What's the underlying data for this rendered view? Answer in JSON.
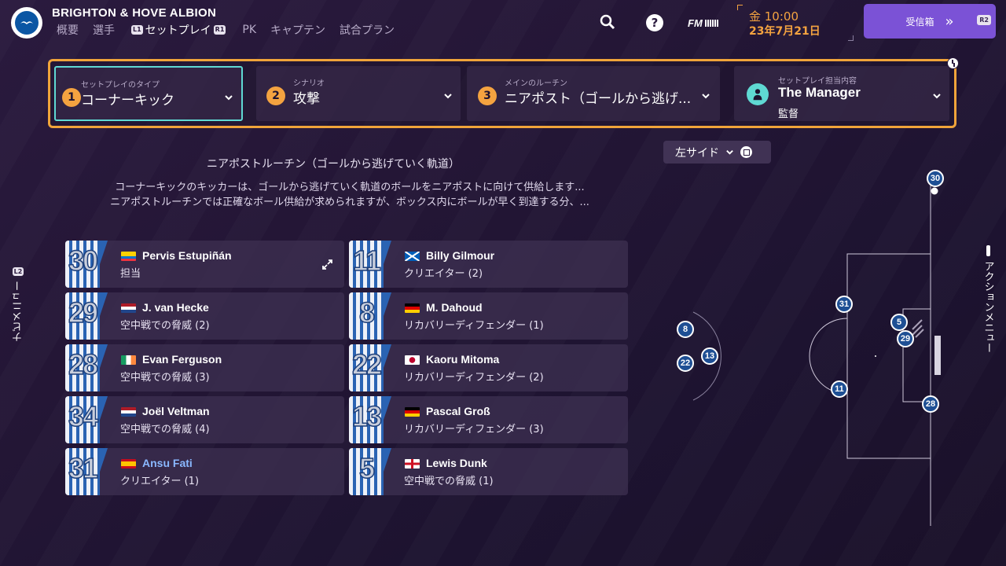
{
  "header": {
    "club_name": "BRIGHTON & HOVE ALBION",
    "nav": [
      {
        "label": "概要"
      },
      {
        "label": "選手"
      },
      {
        "label": "セットプレイ",
        "key_left": "L1",
        "key_right": "R1",
        "active": true
      },
      {
        "label": "PK"
      },
      {
        "label": "キャプテン"
      },
      {
        "label": "試合プラン"
      }
    ],
    "fm_logo": "FM",
    "help_glyph": "?",
    "date_time": "金 10:00",
    "date_date": "23年7月21日",
    "inbox_label": "受信箱",
    "inbox_arrows": "»",
    "inbox_key": "R2"
  },
  "setpiece": {
    "type": {
      "num": "1",
      "caption": "セットプレイのタイプ",
      "value": "コーナーキック"
    },
    "scenario": {
      "num": "2",
      "caption": "シナリオ",
      "value": "攻撃"
    },
    "routine": {
      "num": "3",
      "caption": "メインのルーチン",
      "value": "ニアポスト（ゴールから逃げ..."
    },
    "taker": {
      "caption": "セットプレイ担当内容",
      "value": "The Manager",
      "sub": "監督"
    }
  },
  "routine": {
    "title": "ニアポストルーチン（ゴールから逃げていく軌道）",
    "desc_line1": "コーナーキックのキッカーは、ゴールから逃げていく軌道のボールをニアポストに向けて供給します...",
    "desc_line2": "ニアポストルーチンでは正確なボール供給が求められますが、ボックス内にボールが早く到達する分、..."
  },
  "players_left": [
    {
      "num": "30",
      "name": "Pervis Estupiñán",
      "role": "担当",
      "flag": "ecuador",
      "highlight": false
    },
    {
      "num": "29",
      "name": "J. van Hecke",
      "role": "空中戦での脅威 (2)",
      "flag": "netherlands",
      "highlight": false
    },
    {
      "num": "28",
      "name": "Evan Ferguson",
      "role": "空中戦での脅威 (3)",
      "flag": "ireland",
      "highlight": false
    },
    {
      "num": "34",
      "name": "Joël Veltman",
      "role": "空中戦での脅威 (4)",
      "flag": "netherlands",
      "highlight": false
    },
    {
      "num": "31",
      "name": "Ansu Fati",
      "role": "クリエイター (1)",
      "flag": "spain",
      "highlight": true
    }
  ],
  "players_right": [
    {
      "num": "11",
      "name": "Billy Gilmour",
      "role": "クリエイター (2)",
      "flag": "scotland"
    },
    {
      "num": "8",
      "name": "M. Dahoud",
      "role": "リカバリーディフェンダー (1)",
      "flag": "germany"
    },
    {
      "num": "22",
      "name": "Kaoru Mitoma",
      "role": "リカバリーディフェンダー (2)",
      "flag": "japan"
    },
    {
      "num": "13",
      "name": "Pascal Groß",
      "role": "リカバリーディフェンダー (3)",
      "flag": "germany"
    },
    {
      "num": "5",
      "name": "Lewis Dunk",
      "role": "空中戦での脅威 (1)",
      "flag": "england"
    }
  ],
  "side_nav": {
    "key": "L2",
    "label": "ナビメニュー"
  },
  "side_actions": {
    "label": "アクションメニュー"
  },
  "pitch": {
    "side_select": "左サイド",
    "markers": [
      "30",
      "31",
      "5",
      "29",
      "8",
      "13",
      "22",
      "11",
      "28"
    ]
  },
  "colors": {
    "accent": "#f4a340",
    "highlight": "#5fd9d3",
    "inbox": "#7b52d6"
  }
}
